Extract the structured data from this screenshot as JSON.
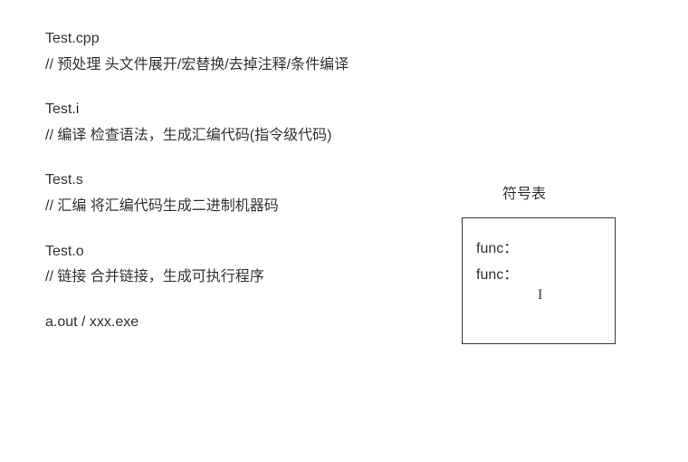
{
  "left": {
    "block1": {
      "line1": "Test.cpp",
      "line2": "// 预处理   头文件展开/宏替换/去掉注释/条件编译"
    },
    "block2": {
      "line1": "Test.i",
      "line2": "// 编译    检查语法，生成汇编代码(指令级代码)"
    },
    "block3": {
      "line1": "Test.s",
      "line2": "// 汇编    将汇编代码生成二进制机器码"
    },
    "block4": {
      "line1": "Test.o",
      "line2": "// 链接    合并链接，生成可执行程序"
    },
    "block5": {
      "line1": "a.out / xxx.exe"
    }
  },
  "box": {
    "label": "符号表",
    "lines": {
      "l1": "func：",
      "l2": "func："
    }
  },
  "cursor": "I"
}
